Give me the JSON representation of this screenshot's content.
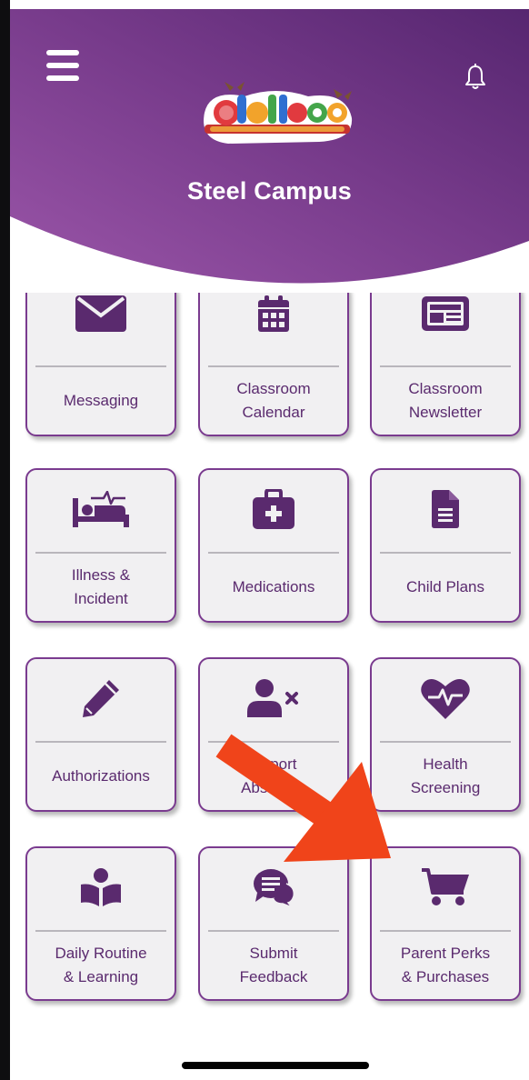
{
  "header": {
    "campus_name": "Steel Campus",
    "logo_alt": "Lullaboo",
    "colors": {
      "purple_dark": "#5b2873",
      "purple_mid": "#7b3c8e",
      "purple_light": "#9a55a8"
    }
  },
  "tiles": [
    {
      "label": "Messaging",
      "icon": "envelope-icon"
    },
    {
      "label": "Classroom\nCalendar",
      "icon": "calendar-icon"
    },
    {
      "label": "Classroom\nNewsletter",
      "icon": "newsletter-icon"
    },
    {
      "label": "Illness &\nIncident",
      "icon": "bed-heartbeat-icon"
    },
    {
      "label": "Medications",
      "icon": "first-aid-kit-icon"
    },
    {
      "label": "Child Plans",
      "icon": "document-icon"
    },
    {
      "label": "Authorizations",
      "icon": "pencil-icon"
    },
    {
      "label": "Report\nAbsentee",
      "icon": "user-remove-icon"
    },
    {
      "label": "Health\nScreening",
      "icon": "heartbeat-icon"
    },
    {
      "label": "Daily Routine\n& Learning",
      "icon": "reader-icon"
    },
    {
      "label": "Submit\nFeedback",
      "icon": "chat-bubbles-icon"
    },
    {
      "label": "Parent Perks\n& Purchases",
      "icon": "shopping-cart-icon"
    }
  ],
  "annotation": {
    "arrow_color": "#f0441a"
  },
  "accent_color": "#5a2a6e",
  "tile_border_color": "#7a3b8f"
}
